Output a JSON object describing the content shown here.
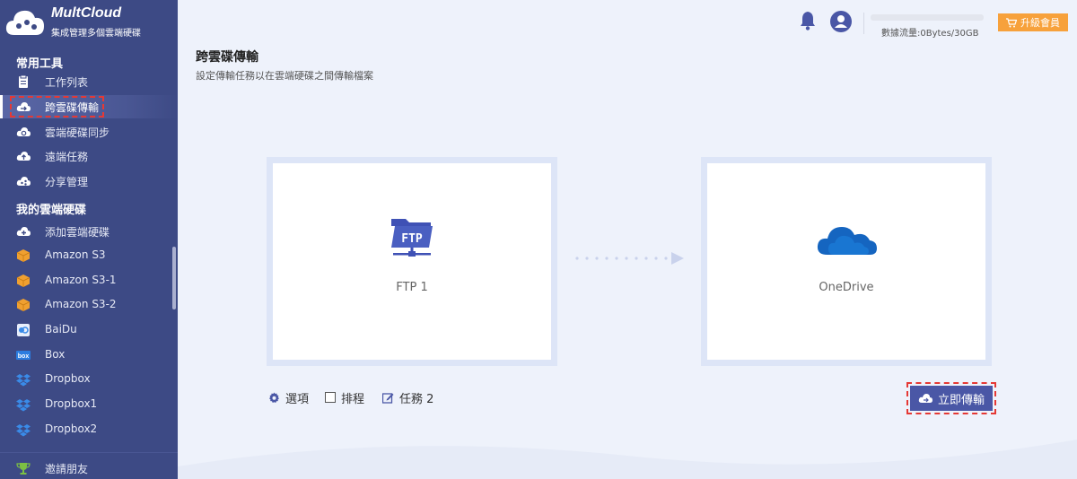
{
  "brand": {
    "name": "MultCloud",
    "tagline": "集成管理多個雲端硬碟"
  },
  "sidebar": {
    "section_tools": "常用工具",
    "tools": [
      {
        "label": "工作列表",
        "icon": "clipboard-icon"
      },
      {
        "label": "跨雲碟傳輸",
        "icon": "cloud-transfer-icon",
        "active": true
      },
      {
        "label": "雲端硬碟同步",
        "icon": "cloud-sync-icon"
      },
      {
        "label": "遠端任務",
        "icon": "cloud-upload-icon"
      },
      {
        "label": "分享管理",
        "icon": "cloud-share-icon"
      }
    ],
    "section_drives": "我的雲端硬碟",
    "drives": [
      {
        "label": "添加雲端硬碟",
        "icon": "cloud-add-icon"
      },
      {
        "label": "Amazon S3",
        "icon": "amazon-s3-icon"
      },
      {
        "label": "Amazon S3-1",
        "icon": "amazon-s3-icon"
      },
      {
        "label": "Amazon S3-2",
        "icon": "amazon-s3-icon"
      },
      {
        "label": "BaiDu",
        "icon": "baidu-icon"
      },
      {
        "label": "Box",
        "icon": "box-icon"
      },
      {
        "label": "Dropbox",
        "icon": "dropbox-icon"
      },
      {
        "label": "Dropbox1",
        "icon": "dropbox-icon"
      },
      {
        "label": "Dropbox2",
        "icon": "dropbox-icon"
      }
    ],
    "invite": "邀請朋友"
  },
  "topbar": {
    "traffic_text": "數據流量:0Bytes/30GB",
    "traffic_used_fraction": 0,
    "upgrade_label": "升級會員"
  },
  "main": {
    "title": "跨雲碟傳輸",
    "subtitle": "設定傳輸任務以在雲端硬碟之間傳輸檔案",
    "source": {
      "label": "FTP 1",
      "icon": "ftp-icon",
      "icon_text": "FTP"
    },
    "target": {
      "label": "OneDrive",
      "icon": "onedrive-icon"
    },
    "options_label": "選項",
    "schedule_label": "排程",
    "task_label": "任務 2",
    "transfer_button": "立即傳輸"
  },
  "colors": {
    "sidebar_bg": "#3d4a85",
    "accent": "#4a57a6",
    "upgrade": "#f7a13b",
    "highlight": "#e53935",
    "onedrive": "#1565c0"
  }
}
